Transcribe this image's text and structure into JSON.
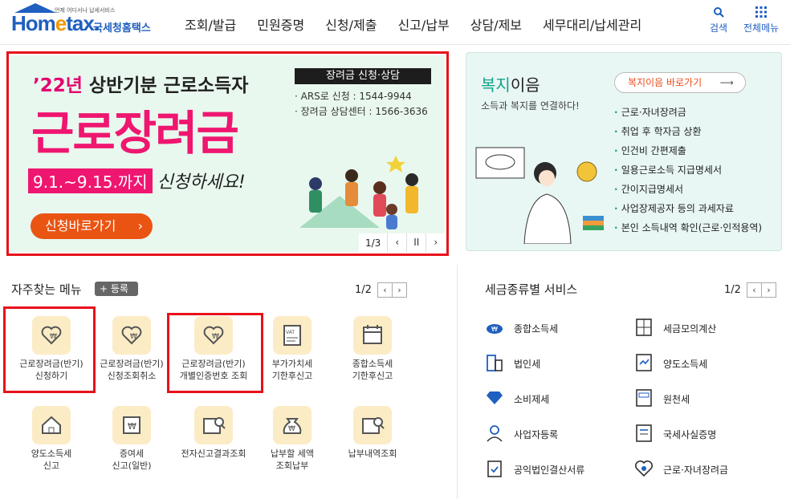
{
  "header": {
    "logo_small": "언제 어디서나 납세서비스",
    "logo_main_a": "Hom",
    "logo_main_e": "e",
    "logo_main_b": "tax.",
    "logo_sub": "국세청홈택스",
    "nav": [
      "조회/발급",
      "민원증명",
      "신청/제출",
      "신고/납부",
      "상담/제보",
      "세무대리/납세관리"
    ],
    "search_label": "검색",
    "menu_label": "전체메뉴"
  },
  "banner": {
    "year_highlight": "’22년",
    "year_rest": "상반기분 근로소득자",
    "title": "근로장려금",
    "box_label": "장려금 신청·상담",
    "info_lines": [
      "· ARS로 신청 : 1544-9944",
      "· 장려금 상담센터 : 1566-3636"
    ],
    "period": "9.1.~9.15.까지",
    "period_suffix": "신청하세요!",
    "button": "신청바로가기",
    "button_arrow": "›",
    "pager": "1/3",
    "prev": "‹",
    "pause": "II",
    "next": "›"
  },
  "welfare": {
    "title_highlight": "복지",
    "title_rest": "이음",
    "desc": "소득과 복지를 연결하다!",
    "button": "복지이음 바로가기",
    "button_arrow": "⟶",
    "items": [
      "근로·자녀장려금",
      "취업 후 학자금 상환",
      "인건비 간편제출",
      "일용근로소득 지급명세서",
      "간이지급명세서",
      "사업장제공자 등의 과세자료",
      "본인 소득내역 확인(근로·인적용역)"
    ]
  },
  "favorites": {
    "title": "자주찾는 메뉴",
    "register": "+ 등록",
    "pager": "1/2",
    "prev": "‹",
    "next": "›",
    "items": [
      {
        "label1": "근로장려금(반기)",
        "label2": "신청하기",
        "icon": "heart-badge-icon"
      },
      {
        "label1": "근로장려금(반기)",
        "label2": "신청조회취소",
        "icon": "heart-badge-icon"
      },
      {
        "label1": "근로장려금(반기)",
        "label2": "개별인증번호 조회",
        "icon": "heart-badge-icon"
      },
      {
        "label1": "부가가치세",
        "label2": "기한후신고",
        "icon": "vat-doc-icon"
      },
      {
        "label1": "종합소득세",
        "label2": "기한후신고",
        "icon": "calendar-pen-icon"
      },
      {
        "label1": "양도소득세",
        "label2": "신고",
        "icon": "house-pen-icon"
      },
      {
        "label1": "증여세",
        "label2": "신고(일반)",
        "icon": "gift-won-icon"
      },
      {
        "label1": "전자신고결과조회",
        "label2": "",
        "icon": "doc-search-icon"
      },
      {
        "label1": "납부할 세액",
        "label2": "조회납부",
        "icon": "money-bag-icon"
      },
      {
        "label1": "납부내역조회",
        "label2": "",
        "icon": "receipt-search-icon"
      }
    ]
  },
  "tax_services": {
    "title": "세금종류별 서비스",
    "pager": "1/2",
    "prev": "‹",
    "next": "›",
    "items": [
      "종합소득세",
      "세금모의계산",
      "법인세",
      "양도소득세",
      "소비제세",
      "원천세",
      "사업자등록",
      "국세사실증명",
      "공익법인결산서류",
      "근로·자녀장려금"
    ]
  },
  "colors": {
    "brand_blue": "#1f5fbf",
    "highlight_red": "#e8111b",
    "banner_pink": "#ef1670",
    "welfare_green": "#13a38a",
    "icon_bg": "#fcecc6"
  }
}
